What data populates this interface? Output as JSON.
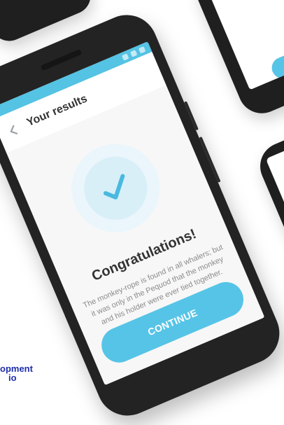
{
  "header": {
    "title": "Your results"
  },
  "result": {
    "headline": "Congratulations!",
    "message": "The monkey-rope is found in all whalers; but it was only in the Pequod that the monkey and his holder were ever tied together."
  },
  "actions": {
    "continue_label": "CONTINUE"
  },
  "brand": {
    "line1": "opment",
    "line2": "io"
  },
  "colors": {
    "accent": "#56c4e6",
    "brand_text": "#1f2fa9"
  }
}
